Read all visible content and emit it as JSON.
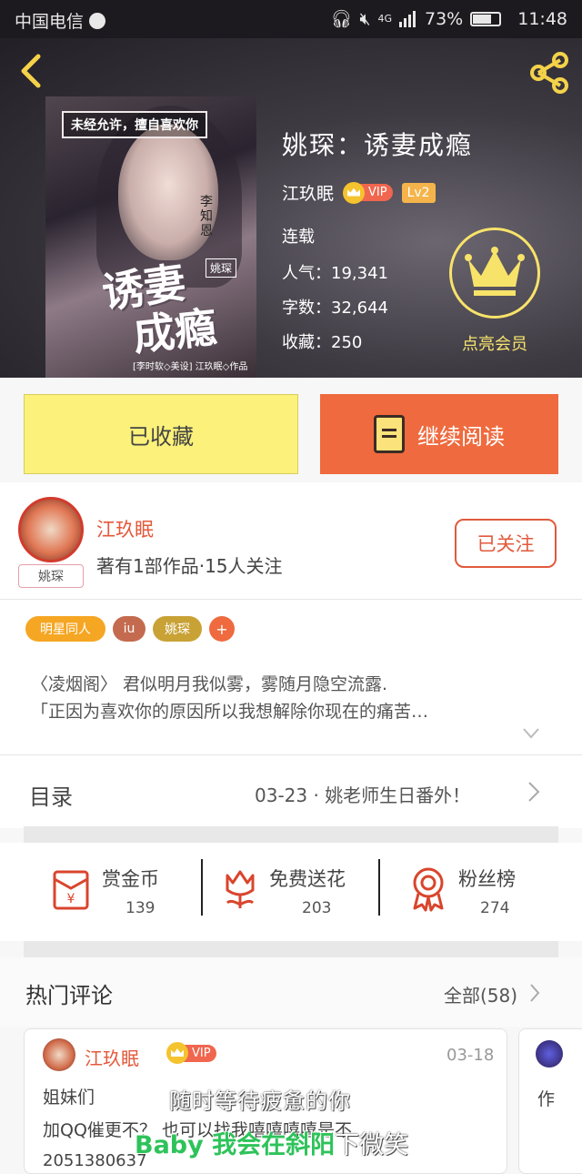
{
  "status_bar": {
    "carrier": "中国电信",
    "network": "4G",
    "battery": "73%",
    "battery_level": 0.73,
    "time": "11:48"
  },
  "book": {
    "title": "姚琛：诱妻成瘾",
    "author": "江玖眠",
    "vip_label": "VIP",
    "level": "Lv2",
    "status": "连载",
    "popularity_label": "人气：",
    "popularity": "19,341",
    "words_label": "字数：",
    "words": "32,644",
    "favorites_label": "收藏：",
    "favorites": "250",
    "vip_action": "点亮会员",
    "cover": {
      "tagline": "未经允许，擅自喜欢你",
      "names": "李知恩",
      "title_line1": "诱妻",
      "title_line2": "成瘾",
      "small_tag": "姚琛",
      "credit": "[李时软◇美设] 江玖眠◇作品"
    }
  },
  "actions": {
    "collected": "已收藏",
    "continue_reading": "继续阅读"
  },
  "author_card": {
    "name": "江玖眠",
    "badge": "姚琛",
    "stats": "著有1部作品·15人关注",
    "follow": "已关注"
  },
  "tags": [
    {
      "label": "明星同人",
      "color": "#f5a623"
    },
    {
      "label": "iu",
      "color": "#c46b4f"
    },
    {
      "label": "姚琛",
      "color": "#c9a236"
    },
    {
      "label": "+",
      "color": "#ef6a3e"
    }
  ],
  "intro": {
    "line1": "〈凌烟阁〉 君似明月我似雾，雾随月隐空流露.",
    "line2": "「正因为喜欢你的原因所以我想解除你现在的痛苦…"
  },
  "catalog": {
    "label": "目录",
    "latest": "03-23 · 姚老师生日番外！"
  },
  "stats": [
    {
      "label": "赏金币",
      "value": "139",
      "icon": "red-envelope-icon"
    },
    {
      "label": "免费送花",
      "value": "203",
      "icon": "flower-icon"
    },
    {
      "label": "粉丝榜",
      "value": "274",
      "icon": "medal-icon"
    }
  ],
  "comments": {
    "title": "热门评论",
    "all": "全部(58)",
    "items": [
      {
        "name": "江玖眠",
        "vip": "VIP",
        "date": "03-18",
        "line1": "姐妹们",
        "line2": "加QQ催更不？ 也可以找我嘻嘻嘻嘻是不",
        "line3": "2051380637"
      },
      {
        "text": "作"
      }
    ]
  },
  "overlay": {
    "line1": "随时等待疲惫的你",
    "line2_green": "Baby 我会在斜阳",
    "line2_white": "下微笑"
  }
}
